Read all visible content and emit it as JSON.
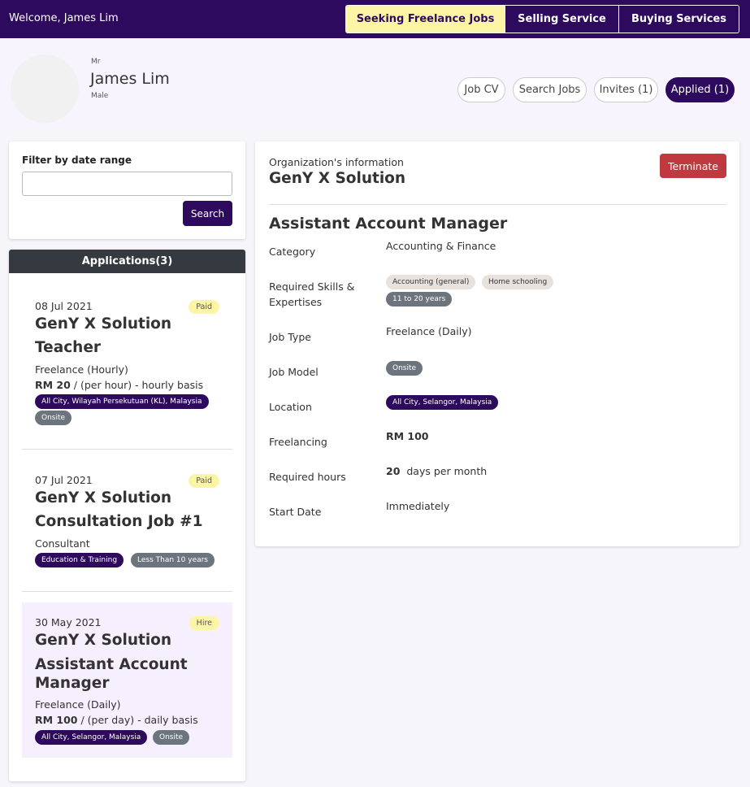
{
  "topbar": {
    "welcome": "Welcome, James Lim",
    "modes": [
      "Seeking Freelance Jobs",
      "Selling Service",
      "Buying Services"
    ]
  },
  "profile": {
    "title": "Mr",
    "name": "James Lim",
    "gender": "Male"
  },
  "nav": {
    "job_cv": "Job CV",
    "search_jobs": "Search Jobs",
    "invites": "Invites (1)",
    "applied": "Applied (1)"
  },
  "filter": {
    "label": "Filter by date range",
    "value": "",
    "button": "Search"
  },
  "applications": {
    "header": "Applications(3)",
    "items": [
      {
        "date": "08 Jul 2021",
        "badge": "Paid",
        "org": "GenY X Solution",
        "title": "Teacher",
        "type": "Freelance (Hourly)",
        "rate_amount": "RM 20",
        "rate_suffix": " / (per hour) - hourly basis",
        "tags": [
          "All City, Wilayah Persekutuan (KL), Malaysia",
          "Onsite"
        ]
      },
      {
        "date": "07 Jul 2021",
        "badge": "Paid",
        "org": "GenY X Solution",
        "title": "Consultation Job #1",
        "type": "Consultant",
        "tags": [
          "Education & Training",
          "Less Than 10 years"
        ]
      },
      {
        "date": "30 May 2021",
        "badge": "Hire",
        "org": "GenY X Solution",
        "title_line1": "Assistant Account",
        "title_line2": "Manager",
        "type": "Freelance (Daily)",
        "rate_amount": "RM 100",
        "rate_suffix": " / (per day) - daily basis",
        "tags": [
          "All City, Selangor, Malaysia",
          "Onsite"
        ]
      }
    ]
  },
  "detail": {
    "org_info_label": "Organization's information",
    "org_name": "GenY X Solution",
    "terminate": "Terminate",
    "job_title": "Assistant Account Manager",
    "labels": {
      "category": "Category",
      "skills_line1": "Required Skills &",
      "skills_line2": "Expertises",
      "job_type": "Job Type",
      "job_model": "Job Model",
      "location": "Location",
      "freelancing": "Freelancing",
      "required_hours": "Required hours",
      "start_date": "Start Date"
    },
    "values": {
      "category": "Accounting & Finance",
      "skills": [
        "Accounting (general)",
        "Home schooling"
      ],
      "experience": "11 to 20 years",
      "job_type": "Freelance (Daily)",
      "job_model": "Onsite",
      "location": "All City, Selangor, Malaysia",
      "freelancing": "RM 100",
      "hours_number": "20",
      "hours_unit": "days per month",
      "start_date": "Immediately"
    }
  },
  "colors": {
    "brand": "#2e0a5f",
    "highlight": "#fdf5a6",
    "danger": "#c0393f",
    "selected_bg": "#f6effe"
  }
}
